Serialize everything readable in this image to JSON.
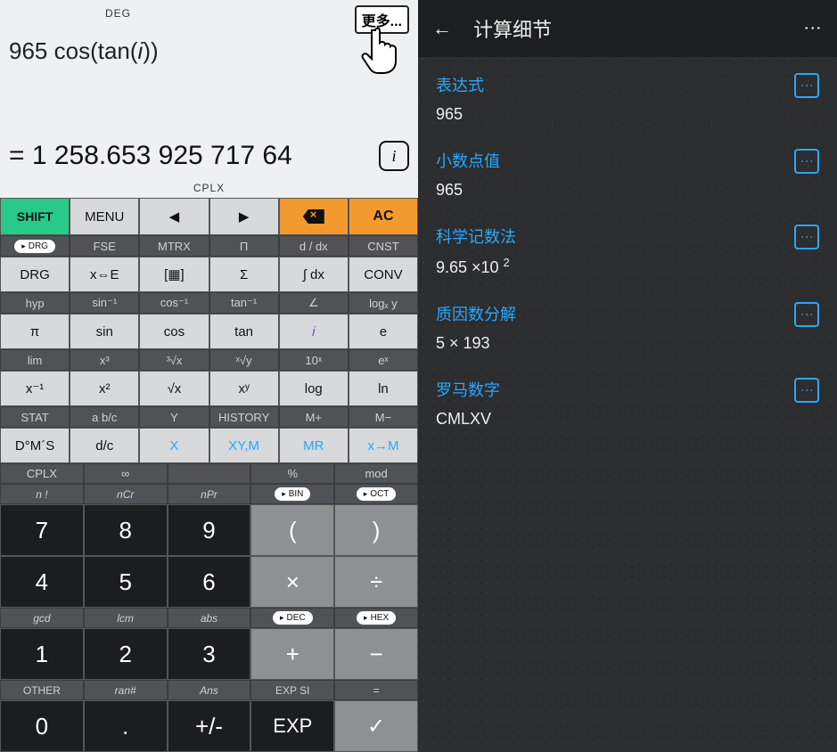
{
  "display": {
    "angle_mode": "DEG",
    "more_label": "更多...",
    "expression": "965 cos(tan(i))",
    "result": "= 1 258.653 925 717 64",
    "info_icon": "i",
    "number_mode": "CPLX"
  },
  "toprow": {
    "shift": "SHIFT",
    "menu": "MENU",
    "left": "◀",
    "right": "▶",
    "bs_icon": "⌫",
    "ac": "AC"
  },
  "hints1": [
    "►DRG",
    "FSE",
    "MTRX",
    "Π",
    "d / dx",
    "CNST"
  ],
  "row2": [
    "DRG",
    "x⇔E",
    "[▦]",
    "Σ",
    "∫ dx",
    "CONV"
  ],
  "hints2": [
    "hyp",
    "sin⁻¹",
    "cos⁻¹",
    "tan⁻¹",
    "∠",
    "logₓ y"
  ],
  "row3": [
    "π",
    "sin",
    "cos",
    "tan",
    "i",
    "e"
  ],
  "hints3": [
    "lim",
    "x³",
    "³√x",
    "ˣ√y",
    "10ˣ",
    "eˣ"
  ],
  "row4": [
    "x⁻¹",
    "x²",
    "√x",
    "xʸ",
    "log",
    "ln"
  ],
  "hints4": [
    "STAT",
    "a b/c",
    "Y",
    "HISTORY",
    "M+",
    "M−"
  ],
  "row5": [
    "D°M´S",
    "d/c",
    "X",
    "XY,M",
    "MR",
    "x→M"
  ],
  "hints5": [
    "CPLX",
    "∞",
    "",
    "%",
    "mod"
  ],
  "numrows": {
    "h1": [
      "n !",
      "nCr",
      "nPr",
      "►BIN",
      "►OCT"
    ],
    "r1": [
      "7",
      "8",
      "9",
      "(",
      ")"
    ],
    "h2": [
      "",
      "",
      "",
      "",
      ""
    ],
    "r2": [
      "4",
      "5",
      "6",
      "×",
      "÷"
    ],
    "h3": [
      "gcd",
      "lcm",
      "abs",
      "►DEC",
      "►HEX"
    ],
    "r3": [
      "1",
      "2",
      "3",
      "+",
      "−"
    ],
    "h4": [
      "OTHER",
      "ran#",
      "Ans",
      "EXP SI",
      "="
    ],
    "r4": [
      "0",
      ".",
      "+/-",
      "EXP",
      "✓"
    ]
  },
  "detail": {
    "title": "计算细节",
    "sections": [
      {
        "head": "表达式",
        "value": "965"
      },
      {
        "head": "小数点值",
        "value": "965"
      },
      {
        "head": "科学记数法",
        "value": "9.65 ×10 ²",
        "sci": true
      },
      {
        "head": "质因数分解",
        "value": "5 × 193"
      },
      {
        "head": "罗马数字",
        "value": "CMLXV"
      }
    ]
  }
}
